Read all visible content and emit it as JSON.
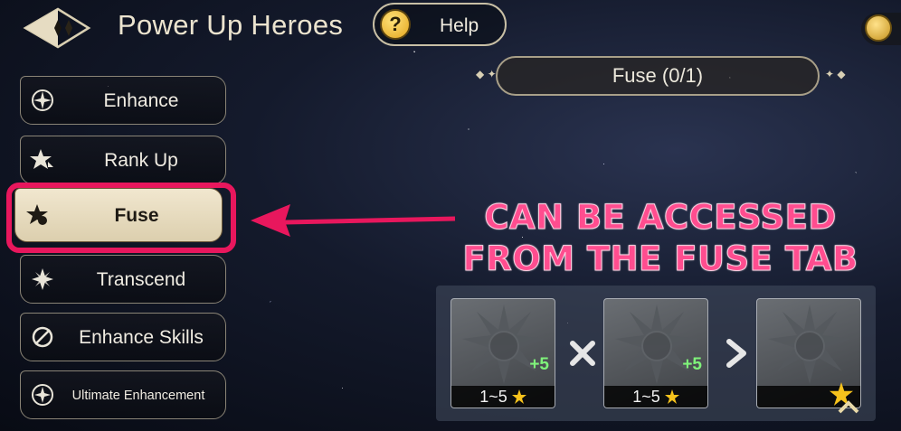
{
  "header": {
    "title": "Power Up Heroes",
    "help_label": "Help",
    "help_symbol": "?"
  },
  "fuse_counter": "Fuse (0/1)",
  "sidebar": {
    "tabs": [
      {
        "label": "Enhance",
        "icon": "enhance-icon",
        "active": false
      },
      {
        "label": "Rank Up",
        "icon": "rank-up-icon",
        "active": false
      },
      {
        "label": "Fuse",
        "icon": "fuse-icon",
        "active": true
      },
      {
        "label": "Transcend",
        "icon": "transcend-icon",
        "active": false
      },
      {
        "label": "Enhance Skills",
        "icon": "enhance-skills-icon",
        "active": false
      },
      {
        "label": "Ultimate Enhancement",
        "icon": "ultimate-enhancement-icon",
        "active": false
      }
    ]
  },
  "annotation": {
    "line1": "CAN BE ACCESSED",
    "line2": "FROM THE FUSE TAB",
    "color": "#ff4d8f",
    "highlight_color": "#e8175d"
  },
  "fuse_slots": [
    {
      "bonus": "+5",
      "level_range": "1~5",
      "icon": "hero-emblem-icon"
    },
    {
      "bonus": "+5",
      "level_range": "1~5",
      "icon": "hero-emblem-icon"
    },
    {
      "bonus": "",
      "level_range": "",
      "icon": "hero-emblem-icon"
    }
  ],
  "operators": {
    "combine": "x-icon",
    "result": "chevron-right-icon"
  }
}
